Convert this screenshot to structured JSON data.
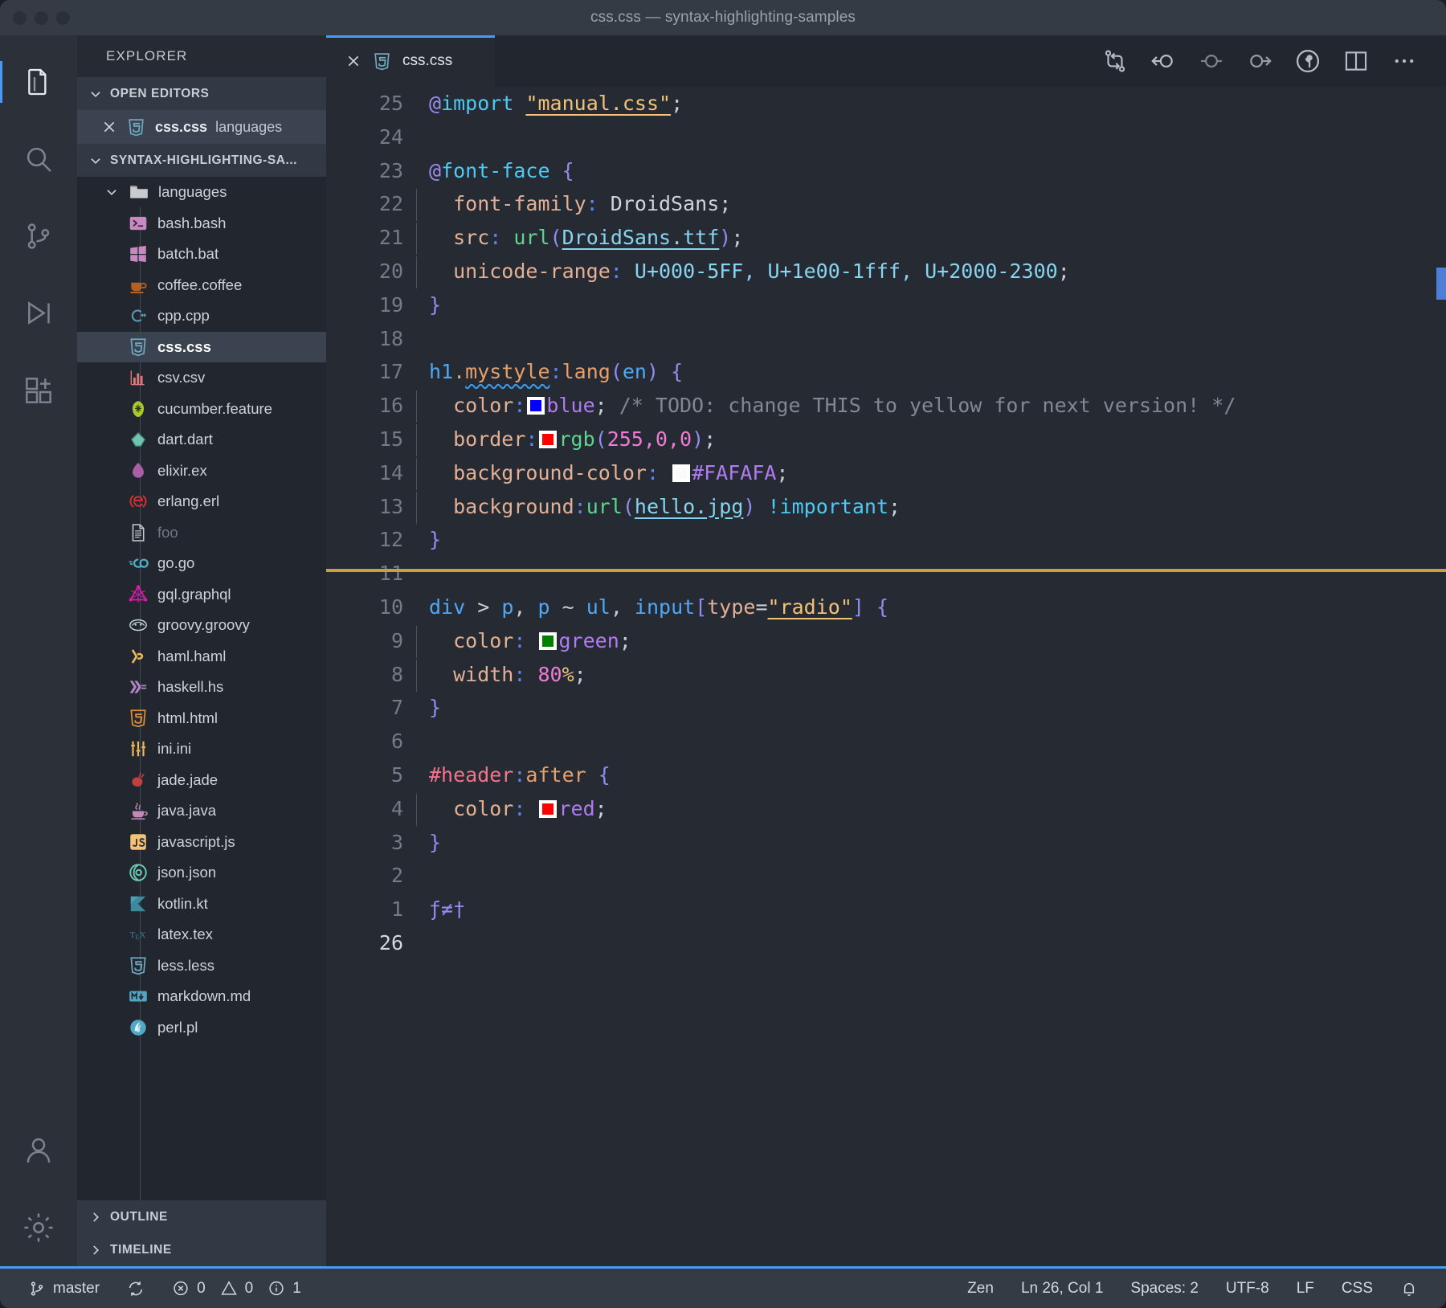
{
  "window": {
    "title": "css.css — syntax-highlighting-samples",
    "traffic_lights": [
      "close",
      "minimize",
      "zoom"
    ]
  },
  "activity_bar": {
    "items": [
      {
        "name": "explorer",
        "icon": "files-icon",
        "active": true
      },
      {
        "name": "search",
        "icon": "search-icon",
        "active": false
      },
      {
        "name": "source-control",
        "icon": "source-control-icon",
        "active": false
      },
      {
        "name": "run-and-debug",
        "icon": "run-debug-icon",
        "active": false
      },
      {
        "name": "extensions",
        "icon": "extensions-icon",
        "active": false
      }
    ],
    "bottom_items": [
      {
        "name": "accounts",
        "icon": "account-icon"
      },
      {
        "name": "manage",
        "icon": "gear-icon"
      }
    ]
  },
  "sidebar": {
    "title": "EXPLORER",
    "open_editors": {
      "label": "OPEN EDITORS",
      "expanded": true,
      "items": [
        {
          "name": "css.css",
          "dir": "languages",
          "icon": "css-icon",
          "selected": true
        }
      ]
    },
    "workspace": {
      "label": "SYNTAX-HIGHLIGHTING-SA...",
      "expanded": true
    },
    "tree": [
      {
        "label": "languages",
        "icon": "folder-icon",
        "type": "folder",
        "expanded": true
      },
      {
        "label": "bash.bash",
        "icon": "bash-icon",
        "type": "file"
      },
      {
        "label": "batch.bat",
        "icon": "batch-icon",
        "type": "file"
      },
      {
        "label": "coffee.coffee",
        "icon": "coffee-icon",
        "type": "file"
      },
      {
        "label": "cpp.cpp",
        "icon": "cpp-icon",
        "type": "file"
      },
      {
        "label": "css.css",
        "icon": "css-icon",
        "type": "file",
        "selected": true
      },
      {
        "label": "csv.csv",
        "icon": "csv-icon",
        "type": "file"
      },
      {
        "label": "cucumber.feature",
        "icon": "cucumber-icon",
        "type": "file"
      },
      {
        "label": "dart.dart",
        "icon": "dart-icon",
        "type": "file"
      },
      {
        "label": "elixir.ex",
        "icon": "elixir-icon",
        "type": "file"
      },
      {
        "label": "erlang.erl",
        "icon": "erlang-icon",
        "type": "file"
      },
      {
        "label": "foo",
        "icon": "plain-file-icon",
        "type": "file",
        "dim": true
      },
      {
        "label": "go.go",
        "icon": "go-icon",
        "type": "file"
      },
      {
        "label": "gql.graphql",
        "icon": "graphql-icon",
        "type": "file"
      },
      {
        "label": "groovy.groovy",
        "icon": "groovy-icon",
        "type": "file"
      },
      {
        "label": "haml.haml",
        "icon": "haml-icon",
        "type": "file"
      },
      {
        "label": "haskell.hs",
        "icon": "haskell-icon",
        "type": "file"
      },
      {
        "label": "html.html",
        "icon": "html-icon",
        "type": "file"
      },
      {
        "label": "ini.ini",
        "icon": "ini-icon",
        "type": "file"
      },
      {
        "label": "jade.jade",
        "icon": "jade-icon",
        "type": "file"
      },
      {
        "label": "java.java",
        "icon": "java-icon",
        "type": "file"
      },
      {
        "label": "javascript.js",
        "icon": "js-icon",
        "type": "file"
      },
      {
        "label": "json.json",
        "icon": "json-icon",
        "type": "file"
      },
      {
        "label": "kotlin.kt",
        "icon": "kotlin-icon",
        "type": "file"
      },
      {
        "label": "latex.tex",
        "icon": "latex-icon",
        "type": "file"
      },
      {
        "label": "less.less",
        "icon": "less-icon",
        "type": "file"
      },
      {
        "label": "markdown.md",
        "icon": "markdown-icon",
        "type": "file"
      },
      {
        "label": "perl.pl",
        "icon": "perl-icon",
        "type": "file"
      }
    ],
    "bottom_sections": [
      {
        "label": "OUTLINE",
        "expanded": false
      },
      {
        "label": "TIMELINE",
        "expanded": false
      }
    ]
  },
  "editor": {
    "tabs": [
      {
        "label": "css.css",
        "icon": "css-icon",
        "active": true,
        "close": "close-icon"
      }
    ],
    "actions": [
      {
        "name": "compare-changes",
        "icon": "compare-changes-icon"
      },
      {
        "name": "previous-change",
        "icon": "arrow-circle-left-icon"
      },
      {
        "name": "current-change",
        "icon": "circle-dash-icon"
      },
      {
        "name": "next-change",
        "icon": "circle-arrow-right-icon"
      },
      {
        "name": "source-control-inline",
        "icon": "git-commit-circle-icon"
      },
      {
        "name": "split-editor",
        "icon": "split-editor-icon"
      },
      {
        "name": "more-actions",
        "icon": "ellipsis-icon"
      }
    ],
    "language": "CSS",
    "lines": [
      {
        "n": "25",
        "segments": [
          {
            "t": "@",
            "c": "t-at"
          },
          {
            "t": "import",
            "c": "t-kw"
          },
          {
            "t": " ",
            "c": "t-punc"
          },
          {
            "t": "\"manual.css\"",
            "c": "t-str"
          },
          {
            "t": ";",
            "c": "t-punc"
          }
        ]
      },
      {
        "n": "24",
        "segments": []
      },
      {
        "n": "23",
        "segments": [
          {
            "t": "@",
            "c": "t-at"
          },
          {
            "t": "font-face",
            "c": "t-kw"
          },
          {
            "t": " ",
            "c": "t-punc"
          },
          {
            "t": "{",
            "c": "t-brace"
          }
        ]
      },
      {
        "n": "22",
        "indent": true,
        "segments": [
          {
            "t": "  font-family",
            "c": "t-prop"
          },
          {
            "t": ":",
            "c": "t-colon"
          },
          {
            "t": " DroidSans",
            "c": "t-val"
          },
          {
            "t": ";",
            "c": "t-punc"
          }
        ]
      },
      {
        "n": "21",
        "indent": true,
        "segments": [
          {
            "t": "  src",
            "c": "t-prop"
          },
          {
            "t": ":",
            "c": "t-colon"
          },
          {
            "t": " ",
            "c": "t-punc"
          },
          {
            "t": "url",
            "c": "t-fn"
          },
          {
            "t": "(",
            "c": "t-paren"
          },
          {
            "t": "DroidSans.ttf",
            "c": "t-url"
          },
          {
            "t": ")",
            "c": "t-paren"
          },
          {
            "t": ";",
            "c": "t-punc"
          }
        ]
      },
      {
        "n": "20",
        "indent": true,
        "segments": [
          {
            "t": "  unicode-range",
            "c": "t-prop"
          },
          {
            "t": ":",
            "c": "t-colon"
          },
          {
            "t": " U+000-5FF, U+1e00-1fff, U+2000-2300",
            "c": "t-uni"
          },
          {
            "t": ";",
            "c": "t-punc"
          }
        ]
      },
      {
        "n": "19",
        "segments": [
          {
            "t": "}",
            "c": "t-brace"
          }
        ]
      },
      {
        "n": "18",
        "segments": []
      },
      {
        "n": "17",
        "segments": [
          {
            "t": "h1",
            "c": "t-el"
          },
          {
            "t": ".",
            "c": "t-cls"
          },
          {
            "t": "mystyle",
            "c": "t-cls squiggle"
          },
          {
            "t": ":",
            "c": "t-colon"
          },
          {
            "t": "lang",
            "c": "t-cls"
          },
          {
            "t": "(",
            "c": "t-paren"
          },
          {
            "t": "en",
            "c": "t-el"
          },
          {
            "t": ")",
            "c": "t-paren"
          },
          {
            "t": " ",
            "c": "t-punc"
          },
          {
            "t": "{",
            "c": "t-brace"
          }
        ]
      },
      {
        "n": "16",
        "indent": true,
        "segments": [
          {
            "t": "  color",
            "c": "t-prop"
          },
          {
            "t": ":",
            "c": "t-colon"
          },
          {
            "t": "@swatch:#0000ff",
            "c": "swatch"
          },
          {
            "t": "blue",
            "c": "t-const"
          },
          {
            "t": ";",
            "c": "t-punc"
          },
          {
            "t": " /* TODO: change THIS to yellow for next version! */",
            "c": "t-comment"
          }
        ]
      },
      {
        "n": "15",
        "indent": true,
        "segments": [
          {
            "t": "  border",
            "c": "t-prop"
          },
          {
            "t": ":",
            "c": "t-colon"
          },
          {
            "t": "@swatch:#fe0000",
            "c": "swatch"
          },
          {
            "t": "rgb",
            "c": "t-fn"
          },
          {
            "t": "(",
            "c": "t-paren"
          },
          {
            "t": "255,0,0",
            "c": "t-num"
          },
          {
            "t": ")",
            "c": "t-paren"
          },
          {
            "t": ";",
            "c": "t-punc"
          }
        ]
      },
      {
        "n": "14",
        "indent": true,
        "segments": [
          {
            "t": "  background-color",
            "c": "t-prop"
          },
          {
            "t": ":",
            "c": "t-colon"
          },
          {
            "t": " ",
            "c": "t-punc"
          },
          {
            "t": "@swatch:#fafafa",
            "c": "swatch"
          },
          {
            "t": "#FAFAFA",
            "c": "t-const"
          },
          {
            "t": ";",
            "c": "t-punc"
          }
        ]
      },
      {
        "n": "13",
        "indent": true,
        "segments": [
          {
            "t": "  background",
            "c": "t-prop"
          },
          {
            "t": ":",
            "c": "t-colon"
          },
          {
            "t": "url",
            "c": "t-fn"
          },
          {
            "t": "(",
            "c": "t-paren"
          },
          {
            "t": "hello.jpg",
            "c": "t-url"
          },
          {
            "t": ")",
            "c": "t-paren"
          },
          {
            "t": " ",
            "c": "t-punc"
          },
          {
            "t": "!important",
            "c": "t-imp"
          },
          {
            "t": ";",
            "c": "t-punc"
          }
        ]
      },
      {
        "n": "12",
        "segments": [
          {
            "t": "}",
            "c": "t-brace"
          }
        ]
      },
      {
        "n": "11",
        "segments": []
      },
      {
        "n": "10",
        "segments": [
          {
            "t": "div",
            "c": "t-el"
          },
          {
            "t": " > ",
            "c": "t-punc"
          },
          {
            "t": "p",
            "c": "t-el"
          },
          {
            "t": ", ",
            "c": "t-punc"
          },
          {
            "t": "p",
            "c": "t-el"
          },
          {
            "t": " ~ ",
            "c": "t-punc"
          },
          {
            "t": "ul",
            "c": "t-el"
          },
          {
            "t": ", ",
            "c": "t-punc"
          },
          {
            "t": "input",
            "c": "t-el"
          },
          {
            "t": "[",
            "c": "t-brace"
          },
          {
            "t": "type",
            "c": "t-attr"
          },
          {
            "t": "=",
            "c": "t-punc"
          },
          {
            "t": "\"radio\"",
            "c": "t-str"
          },
          {
            "t": "]",
            "c": "t-brace"
          },
          {
            "t": " ",
            "c": "t-punc"
          },
          {
            "t": "{",
            "c": "t-brace"
          }
        ]
      },
      {
        "n": "9",
        "indent": true,
        "segments": [
          {
            "t": "  color",
            "c": "t-prop"
          },
          {
            "t": ":",
            "c": "t-colon"
          },
          {
            "t": " ",
            "c": "t-punc"
          },
          {
            "t": "@swatch:#008000",
            "c": "swatch"
          },
          {
            "t": "green",
            "c": "t-const"
          },
          {
            "t": ";",
            "c": "t-punc"
          }
        ]
      },
      {
        "n": "8",
        "indent": true,
        "segments": [
          {
            "t": "  width",
            "c": "t-prop"
          },
          {
            "t": ":",
            "c": "t-colon"
          },
          {
            "t": " ",
            "c": "t-punc"
          },
          {
            "t": "80",
            "c": "t-num"
          },
          {
            "t": "%",
            "c": "t-pct"
          },
          {
            "t": ";",
            "c": "t-punc"
          }
        ]
      },
      {
        "n": "7",
        "segments": [
          {
            "t": "}",
            "c": "t-brace"
          }
        ]
      },
      {
        "n": "6",
        "segments": []
      },
      {
        "n": "5",
        "segments": [
          {
            "t": "#header",
            "c": "t-id"
          },
          {
            "t": ":",
            "c": "t-colon"
          },
          {
            "t": "after",
            "c": "t-cls"
          },
          {
            "t": " ",
            "c": "t-punc"
          },
          {
            "t": "{",
            "c": "t-brace"
          }
        ]
      },
      {
        "n": "4",
        "indent": true,
        "segments": [
          {
            "t": "  color",
            "c": "t-prop"
          },
          {
            "t": ":",
            "c": "t-colon"
          },
          {
            "t": " ",
            "c": "t-punc"
          },
          {
            "t": "@swatch:#fe0000",
            "c": "swatch"
          },
          {
            "t": "red",
            "c": "t-const"
          },
          {
            "t": ";",
            "c": "t-punc"
          }
        ]
      },
      {
        "n": "3",
        "segments": [
          {
            "t": "}",
            "c": "t-brace"
          }
        ]
      },
      {
        "n": "2",
        "segments": []
      },
      {
        "n": "1",
        "segments": [
          {
            "t": "ƒ≠†",
            "c": "t-glyph"
          }
        ]
      },
      {
        "n": "26",
        "current": true,
        "segments": []
      }
    ]
  },
  "status_bar": {
    "left": [
      {
        "name": "branch",
        "icon": "source-control-icon",
        "label": "master"
      },
      {
        "name": "sync",
        "icon": "sync-icon",
        "label": ""
      },
      {
        "name": "errors",
        "icon": "error-icon",
        "label": "0"
      },
      {
        "name": "warnings",
        "icon": "warning-icon",
        "label": "0"
      },
      {
        "name": "infos",
        "icon": "info-icon",
        "label": "1"
      }
    ],
    "right": [
      {
        "name": "zen-mode",
        "label": "Zen"
      },
      {
        "name": "cursor-position",
        "label": "Ln 26, Col 1"
      },
      {
        "name": "indentation",
        "label": "Spaces: 2"
      },
      {
        "name": "encoding",
        "label": "UTF-8"
      },
      {
        "name": "eol",
        "label": "LF"
      },
      {
        "name": "language-mode",
        "label": "CSS"
      },
      {
        "name": "notifications",
        "label": "",
        "icon": "bell-icon"
      }
    ]
  },
  "colors": {
    "accent": "#4a9af5",
    "titlebar": "#353b45",
    "sidebar": "#252a33",
    "editor": "#262b33",
    "activitybar": "#2b3039"
  }
}
